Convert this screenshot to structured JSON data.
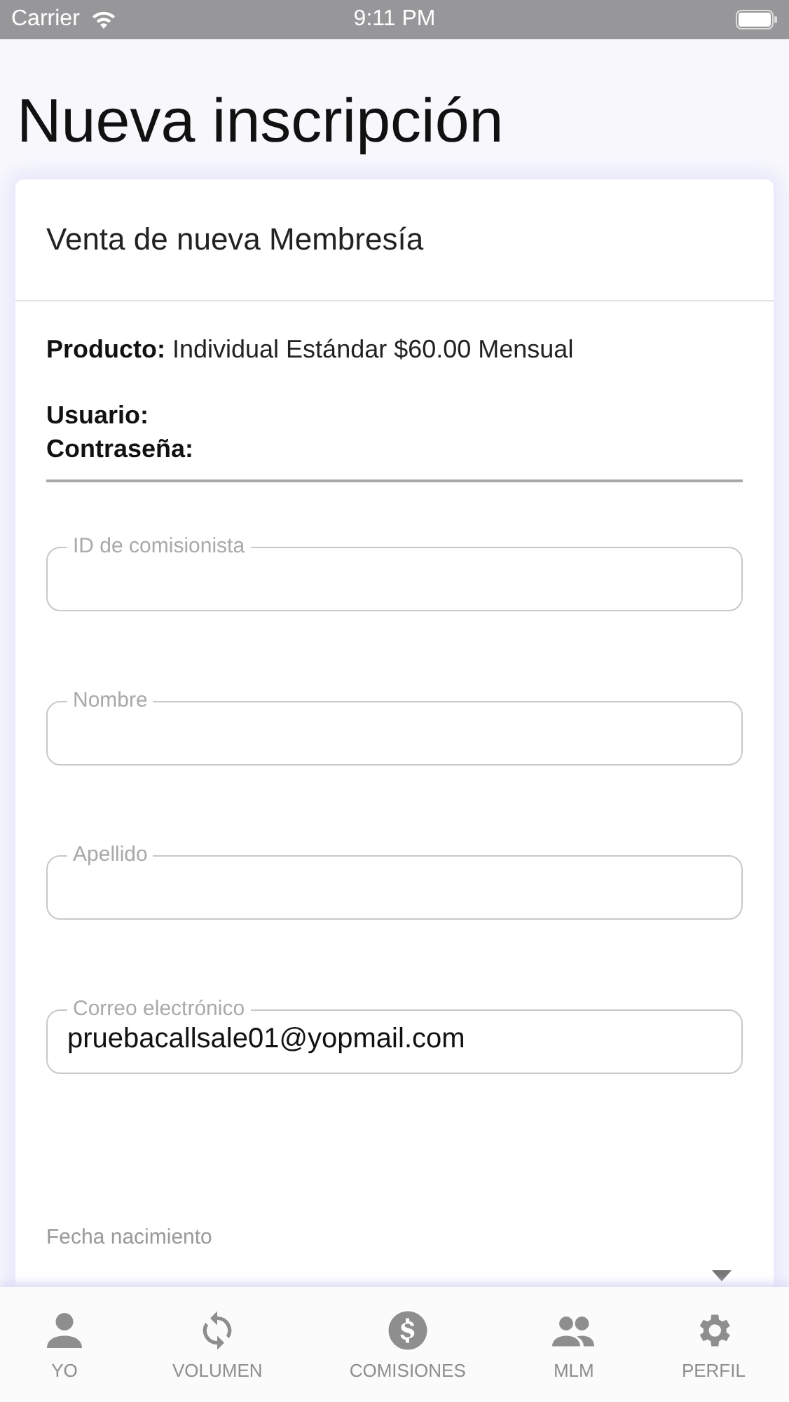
{
  "status_bar": {
    "carrier": "Carrier",
    "time": "9:11 PM"
  },
  "title": "Nueva inscripción",
  "card": {
    "heading": "Venta de nueva Membresía",
    "info": [
      {
        "label": "Producto:",
        "value": "Individual Estándar $60.00 Mensual"
      },
      {
        "label": "Usuario:"
      },
      {
        "label": "Contraseña:"
      }
    ],
    "fields": [
      {
        "kind": "outlined",
        "label": "ID de comisionista"
      },
      {
        "kind": "outlined",
        "label": "Nombre"
      },
      {
        "kind": "outlined",
        "label": "Apellido"
      },
      {
        "kind": "outlined",
        "label": "Correo electrónico",
        "value": "pruebacallsale01@yopmail.com"
      },
      {
        "kind": "select",
        "label": "Fecha nacimiento"
      }
    ]
  },
  "tab_bar": [
    {
      "label": "YO"
    },
    {
      "label": "VOLUMEN"
    },
    {
      "label": "COMISIONES"
    },
    {
      "label": "MLM"
    },
    {
      "label": "PERFIL"
    }
  ]
}
